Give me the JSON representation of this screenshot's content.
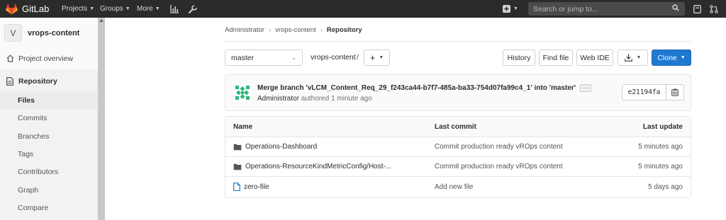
{
  "navbar": {
    "brand": "GitLab",
    "projects": "Projects",
    "groups": "Groups",
    "more": "More",
    "search_placeholder": "Search or jump to..."
  },
  "sidebar": {
    "avatar_letter": "V",
    "project_name": "vrops-content",
    "overview": "Project overview",
    "repository": "Repository",
    "sub_items": [
      "Files",
      "Commits",
      "Branches",
      "Tags",
      "Contributors",
      "Graph",
      "Compare"
    ]
  },
  "breadcrumb": [
    "Administrator",
    "vrops-content",
    "Repository"
  ],
  "toolbar": {
    "branch": "master",
    "path": "vrops-content",
    "slash": "/",
    "history": "History",
    "find_file": "Find file",
    "web_ide": "Web IDE",
    "clone": "Clone"
  },
  "commit": {
    "title": "Merge branch 'vLCM_Content_Req_29_f243ca44-b7f7-485a-ba33-754d07fa99c4_1' into 'master'",
    "ellipsis": "···",
    "author": "Administrator",
    "authored": "authored 1 minute ago",
    "sha": "e21194fa"
  },
  "table": {
    "headers": {
      "name": "Name",
      "last_commit": "Last commit",
      "last_update": "Last update"
    },
    "rows": [
      {
        "type": "folder",
        "name": "Operations-Dashboard",
        "commit": "Commit production ready vROps content",
        "update": "5 minutes ago"
      },
      {
        "type": "folder",
        "name": "Operations-ResourceKindMetricConfig/Host-...",
        "commit": "Commit production ready vROps content",
        "update": "5 minutes ago"
      },
      {
        "type": "file",
        "name": "zero-file",
        "commit": "Add new file",
        "update": "5 days ago"
      }
    ]
  },
  "colors": {
    "navbar": "#2b2b2b",
    "accent": "#1f78d1",
    "logo": "#e24329"
  }
}
